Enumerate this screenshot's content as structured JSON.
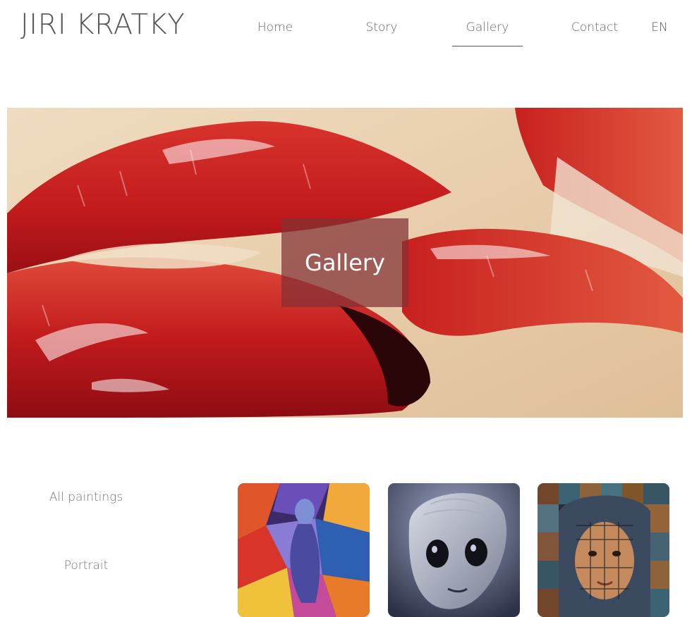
{
  "header": {
    "logo_text": "JIRI KRATKY",
    "nav": [
      {
        "label": "Home",
        "active": false
      },
      {
        "label": "Story",
        "active": false
      },
      {
        "label": "Gallery",
        "active": true
      },
      {
        "label": "Contact",
        "active": false
      }
    ],
    "language": "EN"
  },
  "hero": {
    "title": "Gallery",
    "image": "painting-red-lips",
    "overlay_color": "#823034"
  },
  "filters": [
    {
      "label": "All paintings"
    },
    {
      "label": "Portrait"
    }
  ],
  "gallery": {
    "thumbnails": [
      {
        "image": "cubist-figure-painting"
      },
      {
        "image": "alien-portrait-painting"
      },
      {
        "image": "mosaic-woman-portrait"
      }
    ]
  },
  "colors": {
    "text": "#555555",
    "nav_text": "#666666",
    "filter_text": "#777777",
    "lip_red": "#c41a1e",
    "skin": "#ead4b5"
  }
}
